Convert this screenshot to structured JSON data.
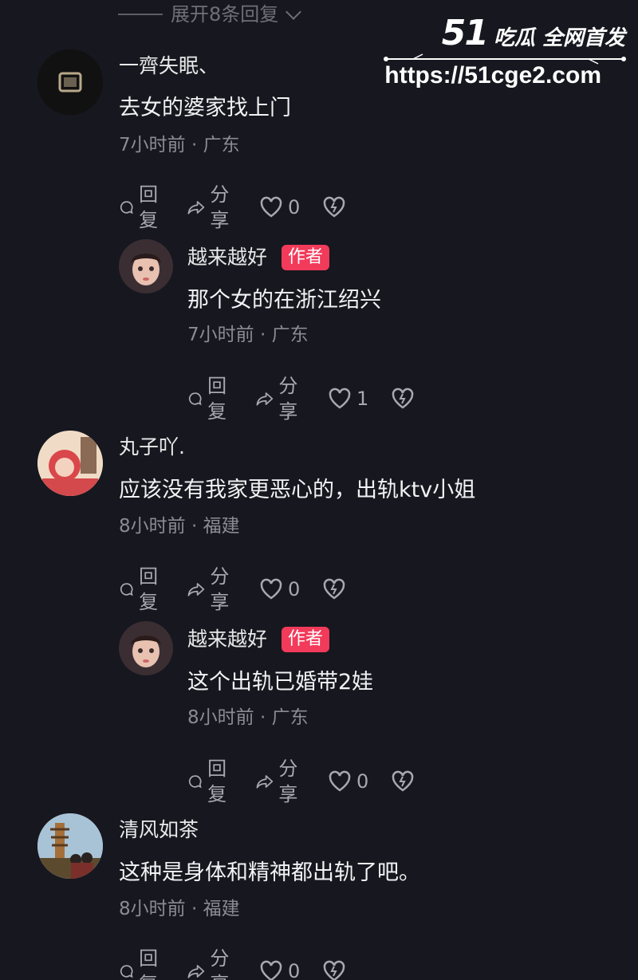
{
  "expand_replies": "展开8条回复",
  "watermark": {
    "logo_num": "51",
    "logo_text": "吃瓜 全网首发",
    "url": "https://51cge2.com"
  },
  "actions": {
    "reply": "回复",
    "share": "分享"
  },
  "comments": [
    {
      "nickname": "一齊失眠、",
      "text": "去女的婆家找上门",
      "time": "7小时前",
      "location": "广东",
      "likes": "0",
      "badge": ""
    },
    {
      "nickname": "越来越好",
      "text": "那个女的在浙江绍兴",
      "time": "7小时前",
      "location": "广东",
      "likes": "1",
      "badge": "作者"
    },
    {
      "nickname": "丸子吖.",
      "text": "应该没有我家更恶心的，出轨ktv小姐",
      "time": "8小时前",
      "location": "福建",
      "likes": "0",
      "badge": ""
    },
    {
      "nickname": "越来越好",
      "text": "这个出轨已婚带2娃",
      "time": "8小时前",
      "location": "广东",
      "likes": "0",
      "badge": "作者"
    },
    {
      "nickname": "清风如茶",
      "text": "这种是身体和精神都出轨了吧。",
      "time": "8小时前",
      "location": "福建",
      "likes": "0",
      "badge": ""
    }
  ],
  "meta_sep": " · "
}
